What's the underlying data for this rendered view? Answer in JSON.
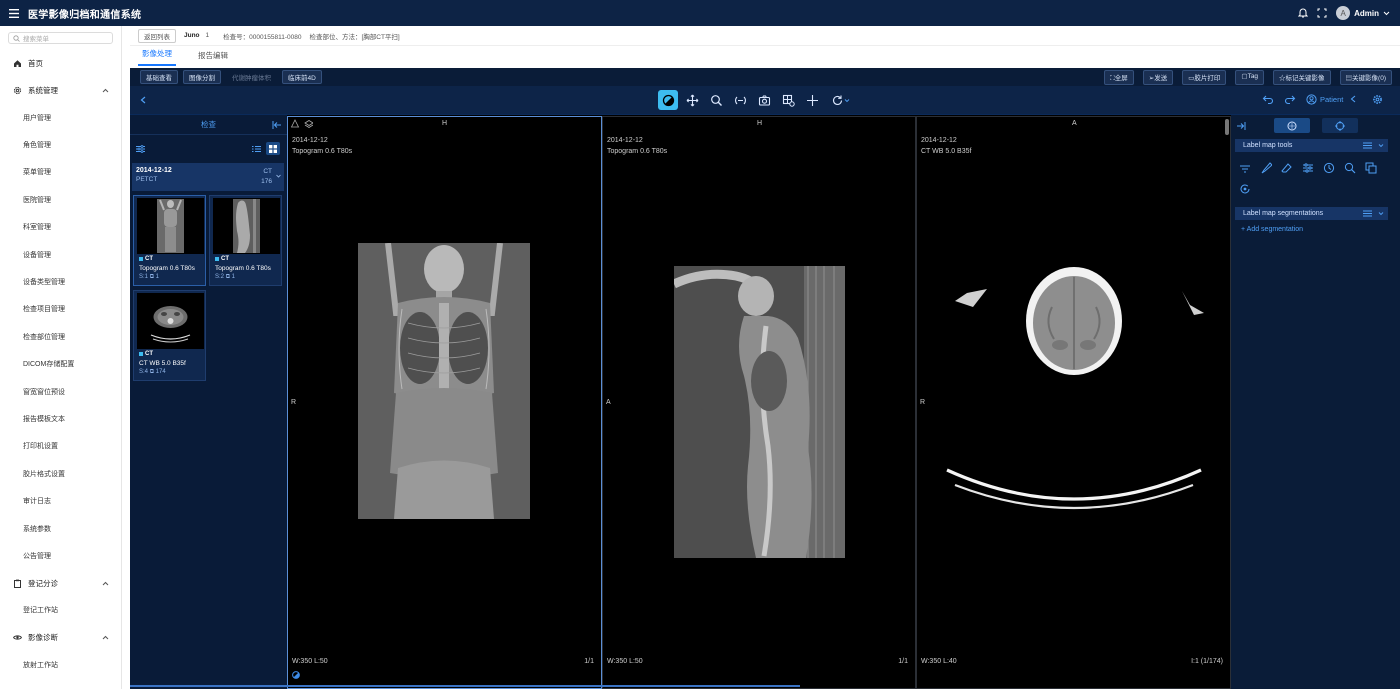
{
  "app": {
    "title": "医学影像归档和通信系统",
    "user": "Admin",
    "avatar_letter": "A"
  },
  "sidebar": {
    "search_placeholder": "搜索菜单",
    "home": "首页",
    "groups": [
      {
        "label": "系统管理",
        "items": [
          "用户管理",
          "角色管理",
          "菜单管理",
          "医院管理",
          "科室管理",
          "设备管理",
          "设备类型管理",
          "检查项目管理",
          "检查部位管理",
          "DICOM存储配置",
          "窗宽窗位预设",
          "报告模板文本",
          "打印机设置",
          "胶片格式设置",
          "审计日志",
          "系统参数",
          "公告管理"
        ]
      },
      {
        "label": "登记分诊",
        "items": [
          "登记工作站"
        ]
      },
      {
        "label": "影像诊断",
        "items": [
          "放射工作站"
        ]
      }
    ]
  },
  "breadcrumb": {
    "back": "返回列表",
    "patient": "Juno",
    "index": "1",
    "exam_no": "检查号：0000155811-0080",
    "exam_part": "检查部位、方法：[胸部CT平扫]"
  },
  "tabs": [
    "影像处理",
    "报告编辑"
  ],
  "viewer_toolbar": {
    "left": [
      "基础查看",
      "图像分割",
      "代谢肿瘤体积",
      "临床前4D"
    ],
    "right": [
      "全屏",
      "发送",
      "胶片打印",
      "Tag",
      "标记关键影像",
      "关键影像(0)"
    ]
  },
  "patient_toggle": "Patient",
  "series_panel": {
    "title": "检查",
    "study": {
      "date": "2014-12-12",
      "desc": "PETCT",
      "modality": "CT",
      "count": "176"
    },
    "thumbnails": [
      {
        "modality": "CT",
        "desc": "Topogram 0.6 T80s",
        "series": "S:1",
        "images": "1"
      },
      {
        "modality": "CT",
        "desc": "Topogram 0.6 T80s",
        "series": "S:2",
        "images": "1"
      },
      {
        "modality": "CT",
        "desc": "CT WB 5.0 B35f",
        "series": "S:4",
        "images": "174"
      }
    ]
  },
  "viewports": [
    {
      "date": "2014-12-12",
      "desc": "Topogram 0.6 T80s",
      "top": "H",
      "left": "R",
      "w": "W:350",
      "l": "L:50",
      "frame": "1/1"
    },
    {
      "date": "2014-12-12",
      "desc": "Topogram 0.6 T80s",
      "top": "H",
      "left": "A",
      "w": "W:350",
      "l": "L:50",
      "frame": "1/1"
    },
    {
      "date": "2014-12-12",
      "desc": "CT WB 5.0 B35f",
      "top": "A",
      "left": "R",
      "w": "W:350",
      "l": "L:40",
      "frame": "I:1 (1/174)"
    }
  ],
  "right_panel": {
    "tools_title": "Label map tools",
    "segmentations_title": "Label map segmentations",
    "add_segmentation": "+ Add segmentation"
  },
  "colors": {
    "topbar": "#0d2345",
    "viewer_bg": "#000000",
    "panel": "#0a1c38",
    "accent": "#3dbcf0",
    "link": "#1677ff"
  }
}
